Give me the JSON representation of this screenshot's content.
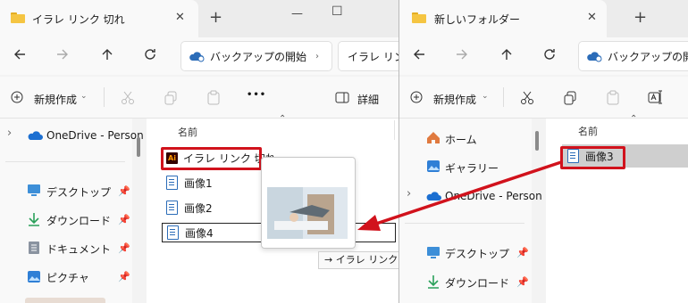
{
  "left_window": {
    "tab_title": "イラレ リンク 切れ",
    "close_glyph": "✕",
    "new_tab_glyph": "+",
    "minimize_glyph": "—",
    "maximize_glyph": "☐",
    "addr_backup": "バックアップの開始",
    "addr_path": "イラレ リン",
    "new_label": "新規作成",
    "more_glyph": "•••",
    "details_label": "詳細",
    "nav_items": [
      {
        "label": "OneDrive - Person"
      },
      {
        "label": "デスクトップ"
      },
      {
        "label": "ダウンロード"
      },
      {
        "label": "ドキュメント"
      },
      {
        "label": "ピクチャ"
      }
    ],
    "col_name": "名前",
    "files": [
      "イラレ リンク 切れ",
      "画像1",
      "画像2",
      "画像4"
    ],
    "drag_tooltip": "→ イラレ リンク 切れ へ移動"
  },
  "right_window": {
    "tab_title": "新しいフォルダー",
    "close_glyph": "✕",
    "new_tab_glyph": "+",
    "addr_backup": "バックアップの開始",
    "new_label": "新規作成",
    "nav_items": [
      {
        "label": "ホーム"
      },
      {
        "label": "ギャラリー"
      },
      {
        "label": "OneDrive - Person"
      },
      {
        "label": "デスクトップ"
      },
      {
        "label": "ダウンロード"
      }
    ],
    "col_name": "名前",
    "files": [
      "画像3"
    ]
  },
  "colors": {
    "highlight": "#d1121c",
    "accent": "#2b6cb8",
    "folder": "#f5c542"
  }
}
